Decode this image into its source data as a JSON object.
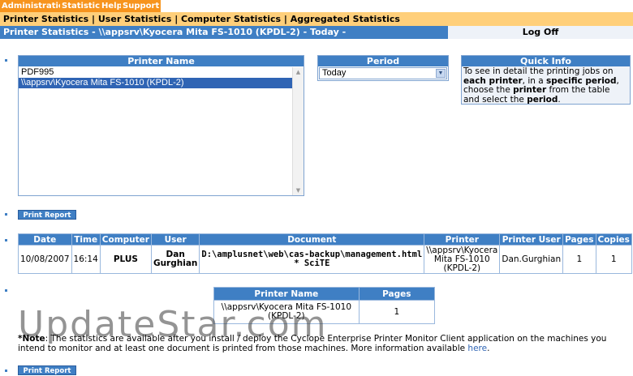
{
  "top_menu": [
    "Administration",
    "Statistics",
    "Help",
    "Support"
  ],
  "sub_nav": [
    "Printer Statistics",
    "User Statistics",
    "Computer Statistics",
    "Aggregated Statistics"
  ],
  "sub_nav_separator": " | ",
  "title_bar": "Printer Statistics - \\\\appsrv\\Kyocera Mita FS-1010 (KPDL-2) - Today -",
  "log_off": "Log Off",
  "printer_panel": {
    "header": "Printer Name",
    "items": [
      "PDF995",
      "\\\\appsrv\\Kyocera Mita FS-1010 (KPDL-2)"
    ],
    "selected_index": 1
  },
  "period_panel": {
    "header": "Period",
    "selected": "Today"
  },
  "quick_info": {
    "header": "Quick Info",
    "t1": "To see in detail the printing jobs on ",
    "b1": "each printer",
    "t2": ", in a ",
    "b2": "specific period",
    "t3": ", choose the ",
    "b3": "printer",
    "t4": " from the table and select the ",
    "b4": "period",
    "t5": "."
  },
  "print_report_label": "Print Report",
  "jobs_table": {
    "headers": [
      "Date",
      "Time",
      "Computer",
      "User",
      "Document",
      "Printer",
      "Printer User",
      "Pages",
      "Copies"
    ],
    "row": {
      "date": "10/08/2007",
      "time": "16:14",
      "computer": "PLUS",
      "user_1": "Dan",
      "user_2": "Gurghian",
      "document_1": "D:\\amplusnet\\web\\cas-backup\\management.html",
      "document_2": "* SciTE",
      "printer_1": "\\\\appsrv\\Kyocera",
      "printer_2": "Mita FS-1010",
      "printer_3": "(KPDL-2)",
      "printer_user": "Dan.Gurghian",
      "pages": "1",
      "copies": "1"
    }
  },
  "summary_table": {
    "headers": [
      "Printer Name",
      "Pages"
    ],
    "printer_1": "\\\\appsrv\\Kyocera Mita FS-1010",
    "printer_2": "(KPDL-2)",
    "pages": "1"
  },
  "watermark": "UpdateStar.com",
  "note": {
    "prefix": "*Note",
    "text": ": The statistics are available after you install / deploy the Cyclope Enterprise Printer Monitor Client application on the machines you intend to monitor and at least one document is printed from those machines. More information available ",
    "link": "here",
    "suffix": "."
  },
  "colors": {
    "menu_orange": "#f7941d",
    "subnav_yellow": "#ffcf7a",
    "header_blue": "#3f7fc4",
    "selected_blue": "#2f64b4"
  }
}
